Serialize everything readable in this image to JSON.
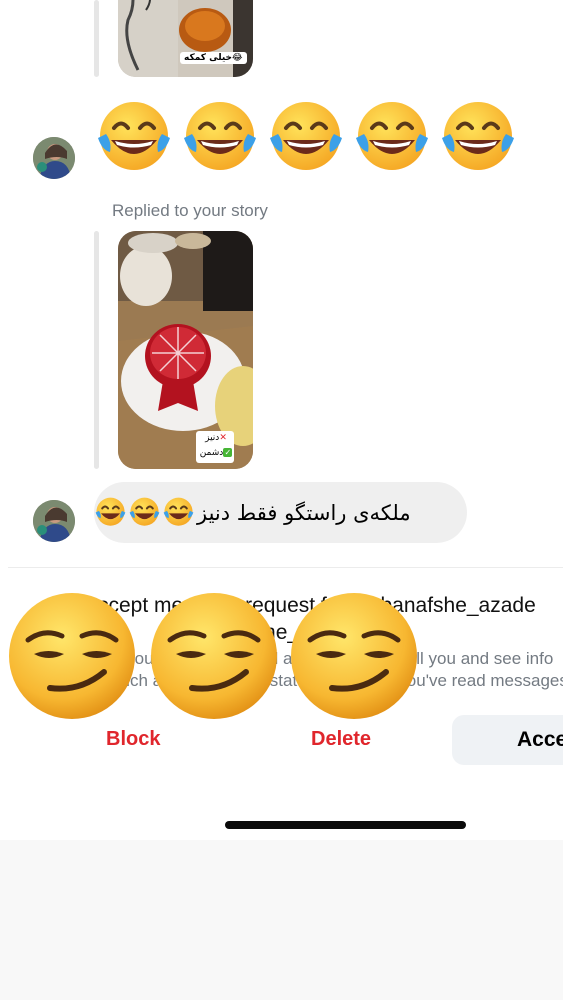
{
  "story_reply_1": {
    "sticker_text": "خیلی کمکه😂"
  },
  "laugh_emojis": [
    "😂",
    "😂",
    "😂",
    "😂",
    "😂"
  ],
  "story_reply_2": {
    "label": "Replied to your story",
    "sticker_line1": "دنیز",
    "sticker_line2": "دشمن"
  },
  "message": {
    "text": "ملکەی  راستگو فقط دنیز",
    "emojis": "😂😂😂"
  },
  "request": {
    "title_line1": "Accept message request from _banafshe_azade",
    "title_line2": "(banafshe_azade)?",
    "desc_line1": "If you accept, they will also be able to call you and see info",
    "desc_line2": "such as your activity status and when you've read messages."
  },
  "overlay_emojis": [
    "😏",
    "😏",
    "😏"
  ],
  "actions": {
    "block": "Block",
    "delete": "Delete",
    "accept": "Accept"
  },
  "colors": {
    "danger": "#e0262c",
    "bubble": "#efefef",
    "secondary_text": "#737a82"
  }
}
